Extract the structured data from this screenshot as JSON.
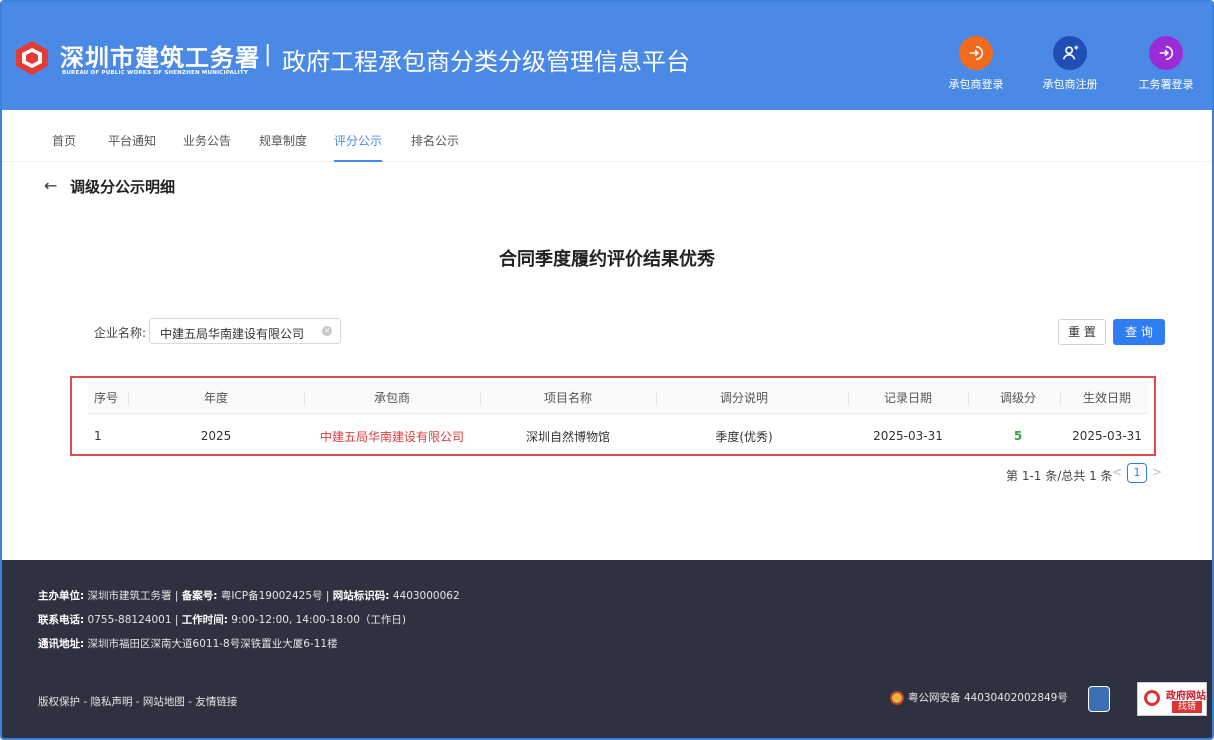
{
  "header": {
    "brand_cn": "深圳市建筑工务署",
    "brand_en": "BUREAU OF PUBLIC WORKS OF SHENZHEN MUNICIPALITY",
    "separator": "|",
    "platform_title": "政府工程承包商分类分级管理信息平台",
    "buttons": [
      {
        "label": "承包商登录",
        "icon": "login-icon",
        "color": "#f26b1d"
      },
      {
        "label": "承包商注册",
        "icon": "user-add-icon",
        "color": "#1f4fb6"
      },
      {
        "label": "工务署登录",
        "icon": "login-icon",
        "color": "#9b2bd6"
      }
    ]
  },
  "nav": {
    "items": [
      {
        "label": "首页"
      },
      {
        "label": "平台通知"
      },
      {
        "label": "业务公告"
      },
      {
        "label": "规章制度"
      },
      {
        "label": "评分公示",
        "active": true
      },
      {
        "label": "排名公示"
      }
    ]
  },
  "page": {
    "back": "←",
    "title": "调级分公示明细",
    "section_title": "合同季度履约评价结果优秀"
  },
  "search": {
    "label": "企业名称:",
    "value": "中建五局华南建设有限公司",
    "clear_icon": "×",
    "reset_label": "重 置",
    "query_label": "查 询"
  },
  "table": {
    "headers": [
      "序号",
      "年度",
      "承包商",
      "项目名称",
      "调分说明",
      "记录日期",
      "调级分",
      "生效日期"
    ],
    "rows": [
      [
        "1",
        "2025",
        "中建五局华南建设有限公司",
        "深圳自然博物馆",
        "季度(优秀)",
        "2025-03-31",
        "5",
        "2025-03-31"
      ]
    ]
  },
  "pagination": {
    "summary": "第 1-1 条/总共 1 条",
    "prev": "<",
    "current": "1",
    "next": ">"
  },
  "footer": {
    "line1": {
      "host_label": "主办单位:",
      "host": "深圳市建筑工务署",
      "sep": "|",
      "icp_label": "备案号:",
      "icp": "粤ICP备19002425号",
      "site_label": "网站标识码:",
      "site": "4403000062"
    },
    "line2": {
      "phone_label": "联系电话:",
      "phone": "0755-88124001",
      "hours_label": "工作时间:",
      "hours": "9:00-12:00, 14:00-18:00（工作日)"
    },
    "line3": {
      "addr_label": "通讯地址:",
      "addr": "深圳市福田区深南大道6011-8号深铁置业大厦6-11楼"
    },
    "links": "版权保护 - 隐私声明 - 网站地图 - 友情链接",
    "police": "粤公网安备 44030402002849号",
    "gov_find_top": "政府网站",
    "gov_find_bottom": "找错"
  }
}
